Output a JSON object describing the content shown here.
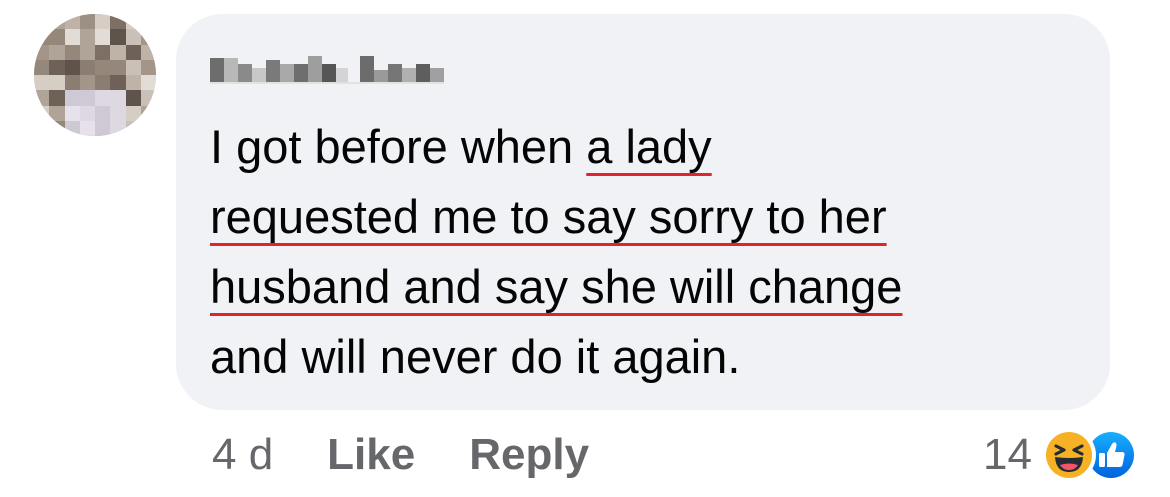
{
  "comment": {
    "author": "",
    "text_lines": [
      {
        "plain": "I got before when ",
        "underlined": "a lady"
      },
      {
        "plain": "",
        "underlined": "requested me to say sorry to her"
      },
      {
        "plain": "",
        "underlined": "husband and say she will change"
      },
      {
        "plain": "and will never do it again.",
        "underlined": ""
      }
    ],
    "timestamp": "4 d",
    "like_label": "Like",
    "reply_label": "Reply",
    "reaction_count": "14",
    "reactions": [
      "haha-icon",
      "like-icon"
    ]
  },
  "colors": {
    "bubble": "#f0f2f5",
    "text": "#050505",
    "meta": "#65676b",
    "underline": "#e0242a",
    "like_blue": "#1877f2",
    "haha_yellow": "#f7b125"
  }
}
